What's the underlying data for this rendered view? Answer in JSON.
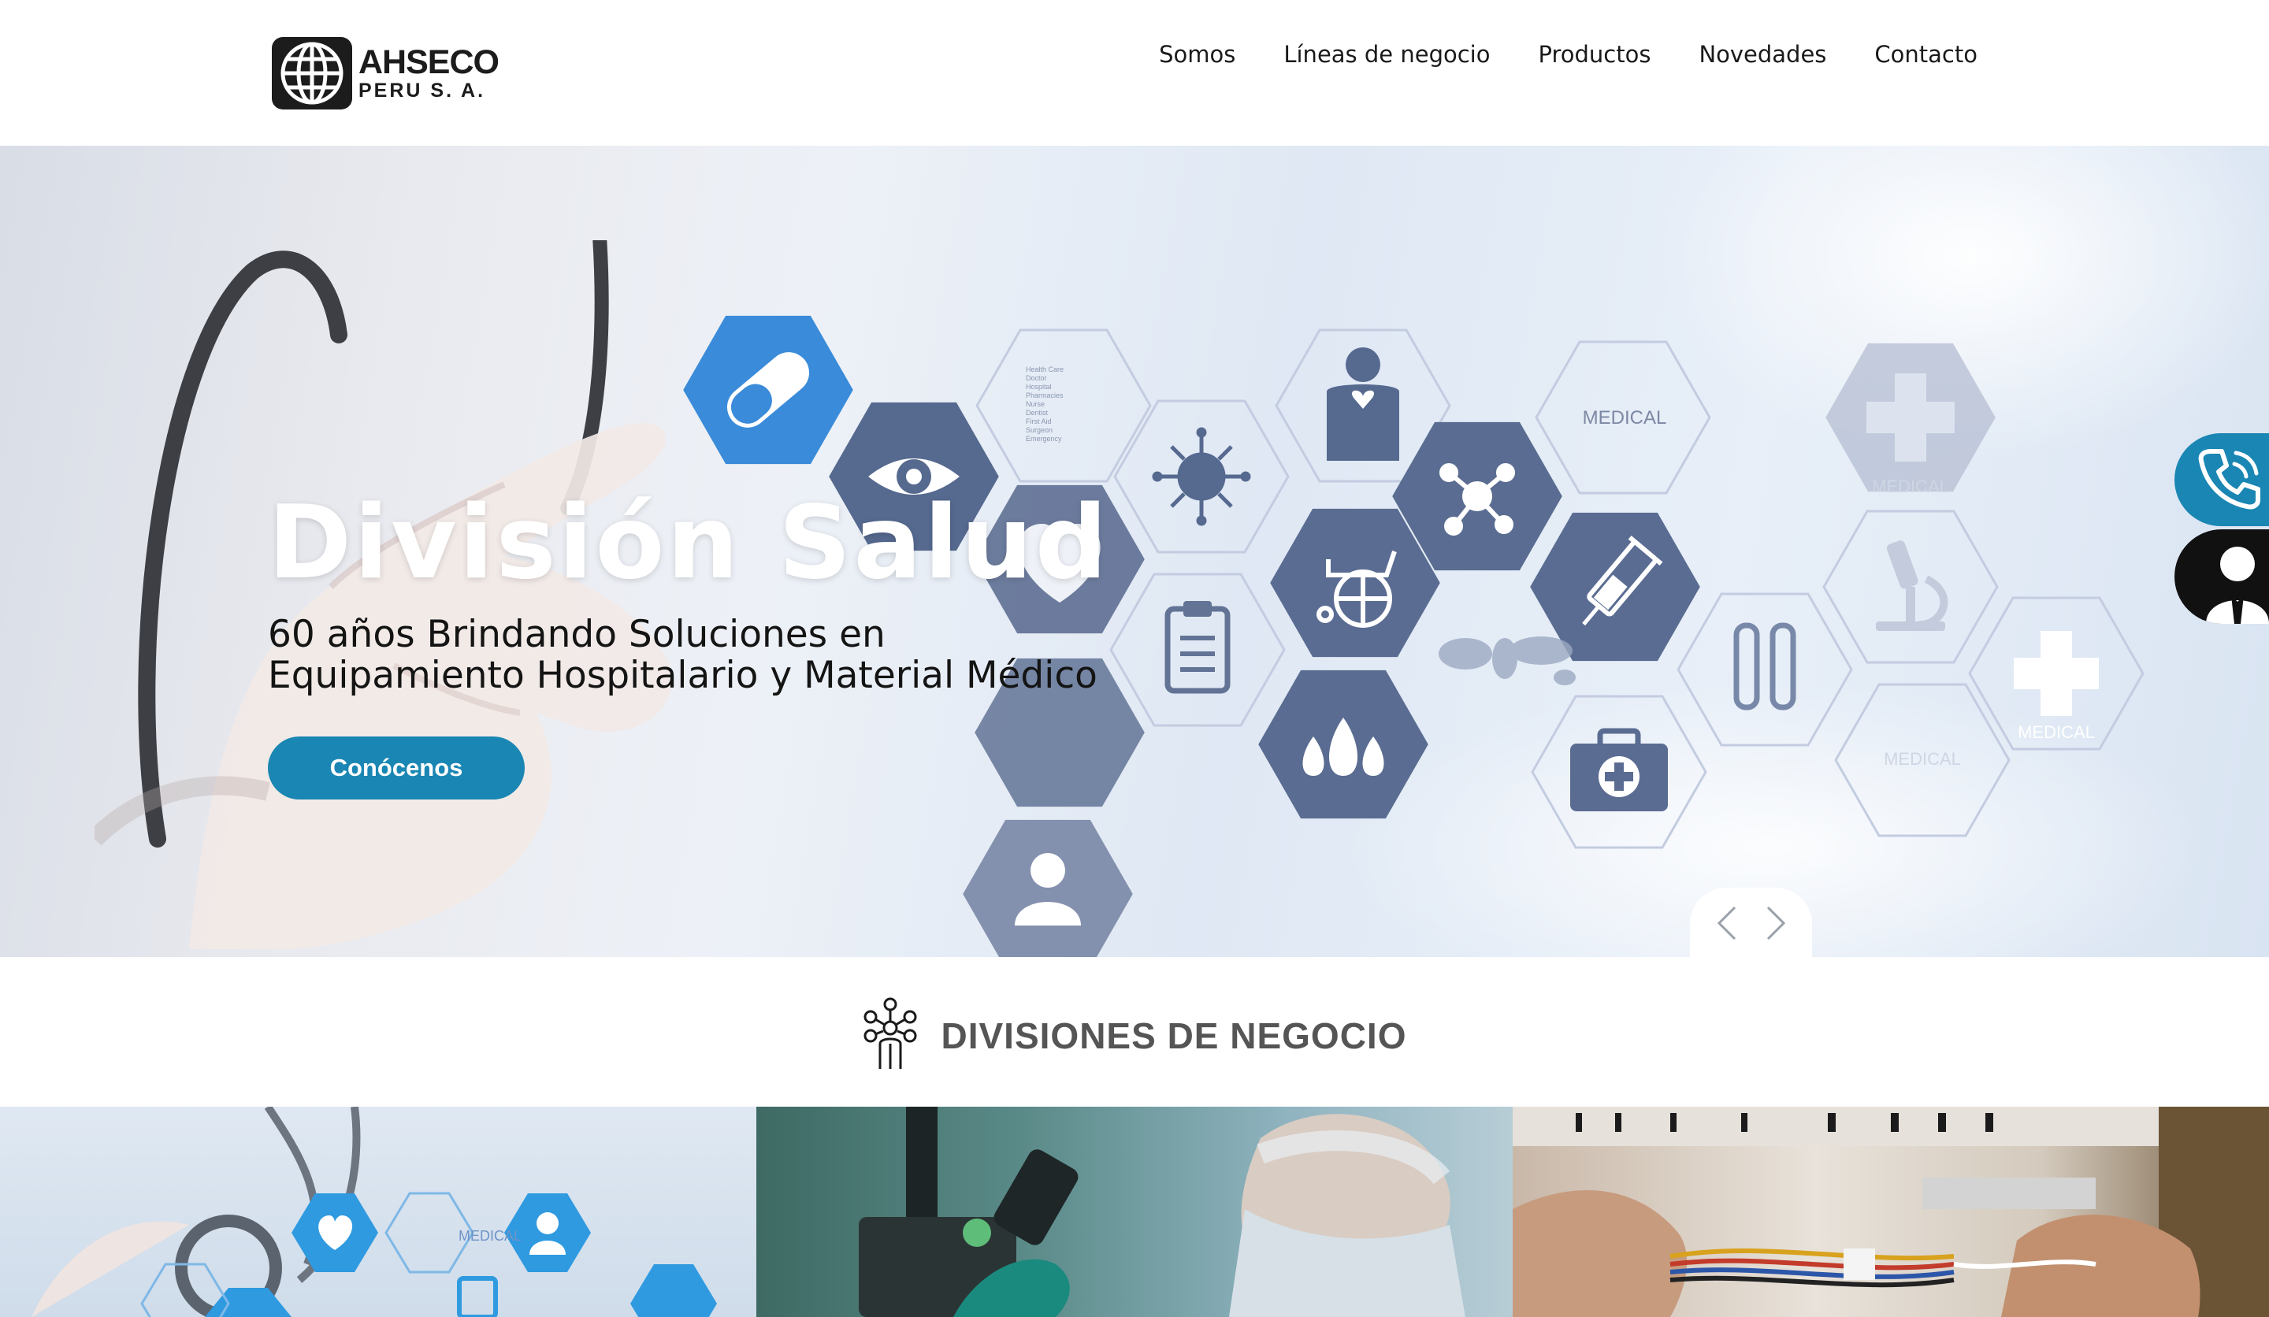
{
  "header": {
    "logo": {
      "name": "AHSECO",
      "subtitle": "PERU S. A."
    },
    "nav": [
      {
        "label": "Somos"
      },
      {
        "label": "Líneas de negocio"
      },
      {
        "label": "Productos"
      },
      {
        "label": "Novedades"
      },
      {
        "label": "Contacto"
      }
    ]
  },
  "hero": {
    "title": "División Salud",
    "subtitle_line1": "60 años Brindando Soluciones en",
    "subtitle_line2": "Equipamiento Hospitalario y Material Médico",
    "cta_label": "Conócenos",
    "hex_labels": [
      "MEDICAL",
      "MEDICAL",
      "MEDICAL",
      "MEDICAL"
    ],
    "chart_list": [
      "Health Care",
      "Doctor",
      "Hospital",
      "Pharmacies",
      "Nurse",
      "Dentist",
      "First Aid",
      "Surgeon",
      "Emergency"
    ]
  },
  "divisions": {
    "heading": "DIVISIONES DE NEGOCIO",
    "tile_labels": [
      "MEDICAL"
    ]
  },
  "colors": {
    "accent": "#1a86b3",
    "hex_dark": "#5c6f94",
    "hex_blue": "#3b8ad8",
    "heading_gray": "#555555"
  }
}
